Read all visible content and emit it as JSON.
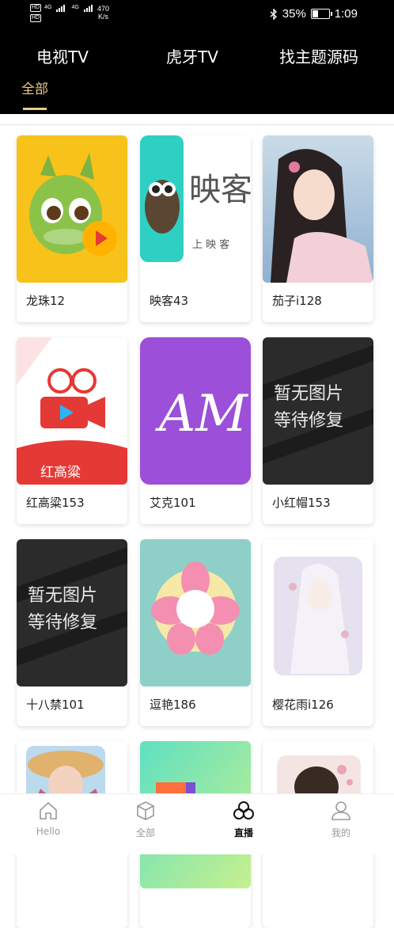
{
  "status_bar": {
    "left_top": "HD",
    "left_bottom": "HD",
    "net_a": "4G",
    "net_b": "4G",
    "speed_value": "470",
    "speed_unit": "K/s",
    "bluetooth_icon": "bluetooth-icon",
    "battery": "35%",
    "battery_level": 0.35,
    "time": "1:09"
  },
  "top_tabs": [
    "电视TV",
    "虎牙TV",
    "找主题源码"
  ],
  "sub_tab": "全部",
  "accent_color": "#e9c98a",
  "placeholder_text": [
    "暂无图片",
    "等待修复"
  ],
  "thumb_texts": {
    "yingke_logo": "映客",
    "yingke_sub": "上 映 客",
    "honggaoliang": "红高粱",
    "aike": "AM"
  },
  "cards": [
    {
      "label": "龙珠12"
    },
    {
      "label": "映客43"
    },
    {
      "label": "茄子i128"
    },
    {
      "label": "红高粱153"
    },
    {
      "label": "艾克101"
    },
    {
      "label": "小红帽153"
    },
    {
      "label": "十八禁101"
    },
    {
      "label": "逗艳186"
    },
    {
      "label": "樱花雨i126"
    },
    {
      "label": ""
    },
    {
      "label": ""
    },
    {
      "label": ""
    }
  ],
  "bottom_nav": [
    {
      "label": "Hello",
      "icon": "home-icon"
    },
    {
      "label": "全部",
      "icon": "cube-icon"
    },
    {
      "label": "直播",
      "icon": "circles-icon",
      "active": true
    },
    {
      "label": "我的",
      "icon": "user-icon"
    }
  ]
}
